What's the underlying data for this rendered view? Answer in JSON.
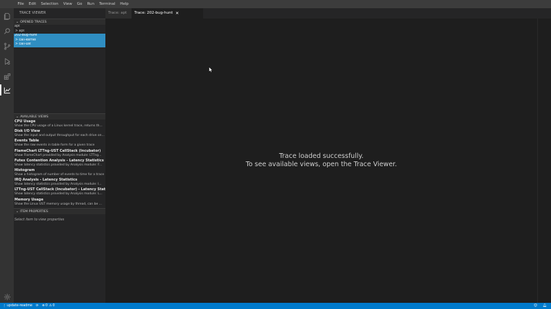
{
  "menu": [
    "File",
    "Edit",
    "Selection",
    "View",
    "Go",
    "Run",
    "Terminal",
    "Help"
  ],
  "sidebar": {
    "title": "TRACE VIEWER",
    "opened_traces_header": "OPENED TRACES",
    "traces": [
      {
        "label": "apt",
        "selected": false
      },
      {
        "label": "> apt",
        "selected": false
      },
      {
        "label": "202-bug-hunt",
        "selected": true
      },
      {
        "label": "> call-kernel",
        "selected": true
      },
      {
        "label": "> call-ust",
        "selected": true
      }
    ],
    "available_views_header": "AVAILABLE VIEWS",
    "views": [
      {
        "title": "CPU Usage",
        "desc": "Show the CPU usage of a Linux kernel trace, returns th..."
      },
      {
        "title": "Disk I/O View",
        "desc": "Show the input and output throughput for each drive on..."
      },
      {
        "title": "Events Table",
        "desc": "Show the raw events in table form for a given trace"
      },
      {
        "title": "FlameChart LTTng-UST CallStack (Incubator)",
        "desc": "Show FlameChart provided by Analysis module: LTTng..."
      },
      {
        "title": "Futex Contention Analysis - Latency Statistics",
        "desc": "Show latency statistics provided by Analysis module: F..."
      },
      {
        "title": "Histogram",
        "desc": "Show a histogram of number of events to time for a trace"
      },
      {
        "title": "IRQ Analysis - Latency Statistics",
        "desc": "Show latency statistics provided by Analysis module: I..."
      },
      {
        "title": "LTTng-UST CallStack (Incubator) - Latency Stati...",
        "desc": "Show latency statistics provided by Analysis module: L..."
      },
      {
        "title": "Memory Usage",
        "desc": "Show the Linux UST memory usage by thread, can be ..."
      }
    ],
    "item_properties_header": "ITEM PROPERTIES",
    "item_properties_placeholder": "Select item to view properties"
  },
  "tabs": [
    {
      "label": "Trace: apt",
      "active": false
    },
    {
      "label": "Trace: 202-bug-hunt",
      "active": true,
      "close": "✕"
    }
  ],
  "editor": {
    "line1": "Trace loaded successfully.",
    "line2": "To see available views, open the Trace Viewer."
  },
  "statusbar": {
    "branch": "update-readme",
    "errors": "0",
    "warnings": "0"
  },
  "colors": {
    "accent": "#007acc",
    "selection": "#2f8ec2"
  }
}
